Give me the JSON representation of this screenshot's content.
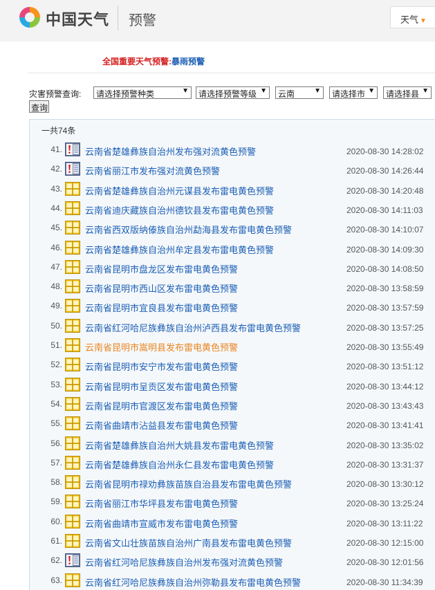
{
  "header": {
    "brand": "中国天气",
    "section_title": "预警",
    "weather_menu": "天气",
    "colors": {
      "accent": "#f28b1e",
      "link": "#1c5fb4",
      "alert_red": "#d42222",
      "highlight": "#e98521"
    }
  },
  "alert": {
    "label": "全国重要天气预警:",
    "link_text": "暴雨预警"
  },
  "query": {
    "label": "灾害预警查询:",
    "type_select": "请选择预警种类",
    "level_select": "请选择预警等级",
    "province_select": "云南",
    "city_select": "请选择市",
    "county_select": "请选择县",
    "search_button": "查询"
  },
  "list": {
    "total": "一共74条",
    "items": [
      {
        "num": "41.",
        "icon": "strong-convection-icon",
        "title": "云南省楚雄彝族自治州发布强对流黄色预警",
        "time": "2020-08-30 14:28:02"
      },
      {
        "num": "42.",
        "icon": "strong-convection-icon",
        "title": "云南省丽江市发布强对流黄色预警",
        "time": "2020-08-30 14:26:44"
      },
      {
        "num": "43.",
        "icon": "thunder-yellow-icon",
        "title": "云南省楚雄彝族自治州元谋县发布雷电黄色预警",
        "time": "2020-08-30 14:20:48"
      },
      {
        "num": "44.",
        "icon": "thunder-yellow-icon",
        "title": "云南省迪庆藏族自治州德钦县发布雷电黄色预警",
        "time": "2020-08-30 14:11:03"
      },
      {
        "num": "45.",
        "icon": "thunder-yellow-icon",
        "title": "云南省西双版纳傣族自治州勐海县发布雷电黄色预警",
        "time": "2020-08-30 14:10:07"
      },
      {
        "num": "46.",
        "icon": "thunder-yellow-icon",
        "title": "云南省楚雄彝族自治州牟定县发布雷电黄色预警",
        "time": "2020-08-30 14:09:30"
      },
      {
        "num": "47.",
        "icon": "thunder-yellow-icon",
        "title": "云南省昆明市盘龙区发布雷电黄色预警",
        "time": "2020-08-30 14:08:50"
      },
      {
        "num": "48.",
        "icon": "thunder-yellow-icon",
        "title": "云南省昆明市西山区发布雷电黄色预警",
        "time": "2020-08-30 13:58:59"
      },
      {
        "num": "49.",
        "icon": "thunder-yellow-icon",
        "title": "云南省昆明市宜良县发布雷电黄色预警",
        "time": "2020-08-30 13:57:59"
      },
      {
        "num": "50.",
        "icon": "thunder-yellow-icon",
        "title": "云南省红河哈尼族彝族自治州泸西县发布雷电黄色预警",
        "time": "2020-08-30 13:57:25"
      },
      {
        "num": "51.",
        "icon": "thunder-yellow-icon",
        "title": "云南省昆明市嵩明县发布雷电黄色预警",
        "time": "2020-08-30 13:55:49",
        "highlight": true
      },
      {
        "num": "52.",
        "icon": "thunder-yellow-icon",
        "title": "云南省昆明市安宁市发布雷电黄色预警",
        "time": "2020-08-30 13:51:12"
      },
      {
        "num": "53.",
        "icon": "thunder-yellow-icon",
        "title": "云南省昆明市呈贡区发布雷电黄色预警",
        "time": "2020-08-30 13:44:12"
      },
      {
        "num": "54.",
        "icon": "thunder-yellow-icon",
        "title": "云南省昆明市官渡区发布雷电黄色预警",
        "time": "2020-08-30 13:43:43"
      },
      {
        "num": "55.",
        "icon": "thunder-yellow-icon",
        "title": "云南省曲靖市沾益县发布雷电黄色预警",
        "time": "2020-08-30 13:41:41"
      },
      {
        "num": "56.",
        "icon": "thunder-yellow-icon",
        "title": "云南省楚雄彝族自治州大姚县发布雷电黄色预警",
        "time": "2020-08-30 13:35:02"
      },
      {
        "num": "57.",
        "icon": "thunder-yellow-icon",
        "title": "云南省楚雄彝族自治州永仁县发布雷电黄色预警",
        "time": "2020-08-30 13:31:37"
      },
      {
        "num": "58.",
        "icon": "thunder-yellow-icon",
        "title": "云南省昆明市禄劝彝族苗族自治县发布雷电黄色预警",
        "time": "2020-08-30 13:30:12"
      },
      {
        "num": "59.",
        "icon": "thunder-yellow-icon",
        "title": "云南省丽江市华坪县发布雷电黄色预警",
        "time": "2020-08-30 13:25:24"
      },
      {
        "num": "60.",
        "icon": "thunder-yellow-icon",
        "title": "云南省曲靖市宣威市发布雷电黄色预警",
        "time": "2020-08-30 13:11:22"
      },
      {
        "num": "61.",
        "icon": "thunder-yellow-icon",
        "title": "云南省文山壮族苗族自治州广南县发布雷电黄色预警",
        "time": "2020-08-30 12:15:00"
      },
      {
        "num": "62.",
        "icon": "strong-convection-icon",
        "title": "云南省红河哈尼族彝族自治州发布强对流黄色预警",
        "time": "2020-08-30 12:01:56"
      },
      {
        "num": "63.",
        "icon": "thunder-yellow-icon",
        "title": "云南省红河哈尼族彝族自治州弥勒县发布雷电黄色预警",
        "time": "2020-08-30 11:34:39"
      }
    ]
  }
}
